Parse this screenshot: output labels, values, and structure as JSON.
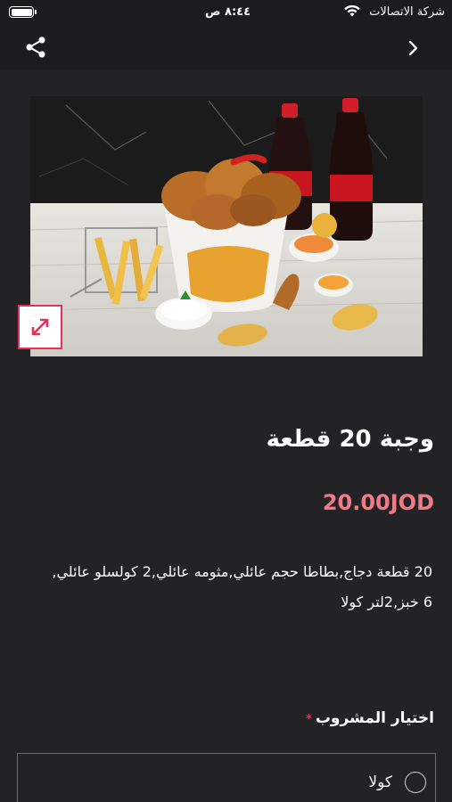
{
  "status_bar": {
    "carrier": "شركة الاتصالات",
    "time": "٨:٤٤ ص"
  },
  "nav": {
    "share_icon": "share-icon",
    "back_icon": "chevron-right-icon"
  },
  "product": {
    "image": "fried-chicken-meal-photo",
    "expand_icon": "expand-arrows-icon",
    "title": "وجبة 20 قطعة",
    "price": "20.00JOD",
    "description": "20 قطعة دجاج,بطاطا حجم عائلي,مثومه عائلي,2 كولسلو عائلي, 6 خبز,2لتر كولا"
  },
  "options": {
    "label": "اختيار المشروب",
    "required_mark": "*",
    "items": [
      {
        "label": "كولا",
        "selected": false
      }
    ]
  },
  "colors": {
    "background": "#232325",
    "price": "#f07b86",
    "accent": "#e0325a"
  }
}
